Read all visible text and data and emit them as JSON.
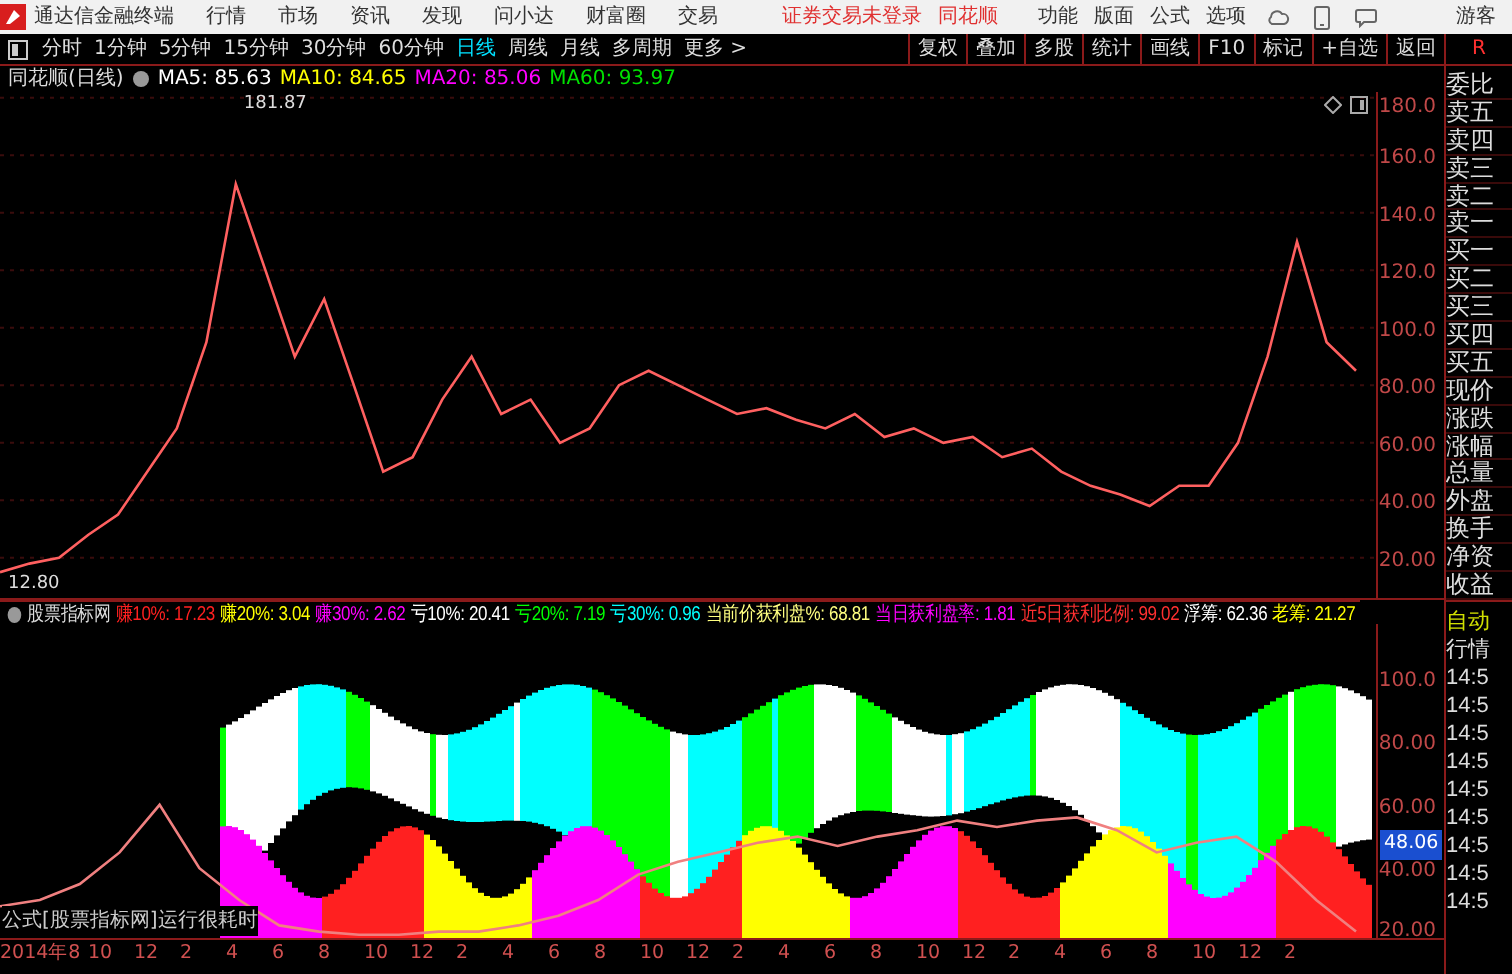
{
  "app": {
    "title": "通达信金融终端",
    "menu": [
      "行情",
      "市场",
      "资讯",
      "发现",
      "问小达",
      "财富圈",
      "交易"
    ],
    "notice": "证券交易未登录",
    "notice_link": "同花顺",
    "tools": [
      "功能",
      "版面",
      "公式",
      "选项"
    ],
    "user": "游客"
  },
  "periods": [
    {
      "label": "分时",
      "selected": false
    },
    {
      "label": "1分钟",
      "selected": false
    },
    {
      "label": "5分钟",
      "selected": false
    },
    {
      "label": "15分钟",
      "selected": false
    },
    {
      "label": "30分钟",
      "selected": false
    },
    {
      "label": "60分钟",
      "selected": false
    },
    {
      "label": "日线",
      "selected": true
    },
    {
      "label": "周线",
      "selected": false
    },
    {
      "label": "月线",
      "selected": false
    },
    {
      "label": "多周期",
      "selected": false
    },
    {
      "label": "更多 >",
      "selected": false
    }
  ],
  "toolbar": [
    "复权",
    "叠加",
    "多股",
    "统计",
    "画线",
    "F10",
    "标记",
    "+自选",
    "返回"
  ],
  "toolbar_badge": "R",
  "price_chart": {
    "title": "同花顺(日线)",
    "ma": [
      {
        "label": "MA5: 85.63",
        "color": "#ffffff"
      },
      {
        "label": "MA10: 84.65",
        "color": "#ffff00"
      },
      {
        "label": "MA20: 85.06",
        "color": "#ff00ff"
      },
      {
        "label": "MA60: 93.97",
        "color": "#00e000"
      }
    ],
    "high_label": "181.87",
    "low_label": "12.80",
    "chart_data": {
      "type": "line",
      "grid": true,
      "ylim": [
        6,
        182
      ],
      "yticks": [
        {
          "value": 180,
          "label": "180.0"
        },
        {
          "value": 160,
          "label": "160.0"
        },
        {
          "value": 140,
          "label": "140.0"
        },
        {
          "value": 120,
          "label": "120.0"
        },
        {
          "value": 100,
          "label": "100.0"
        },
        {
          "value": 80,
          "label": "80.00"
        },
        {
          "value": 60,
          "label": "60.00"
        },
        {
          "value": 40,
          "label": "40.00"
        },
        {
          "value": 20,
          "label": "20.00"
        }
      ],
      "series": [
        {
          "color": "#ff6060",
          "values": [
            15,
            18,
            20,
            28,
            35,
            50,
            65,
            95,
            150,
            120,
            90,
            110,
            80,
            50,
            55,
            75,
            90,
            70,
            75,
            60,
            65,
            80,
            85,
            80,
            75,
            70,
            72,
            68,
            65,
            70,
            62,
            65,
            60,
            62,
            55,
            58,
            50,
            45,
            42,
            38,
            45,
            45,
            60,
            90,
            130,
            95,
            85
          ]
        }
      ]
    }
  },
  "indicator": {
    "title": "股票指标网",
    "items": [
      {
        "label": "赚10%: 17.23",
        "color": "#ff2020"
      },
      {
        "label": "赚20%: 3.04",
        "color": "#ffff00"
      },
      {
        "label": "赚30%: 2.62",
        "color": "#ff00ff"
      },
      {
        "label": "亏10%: 20.41",
        "color": "#ffffff"
      },
      {
        "label": "亏20%: 7.19",
        "color": "#00ff00"
      },
      {
        "label": "亏30%: 0.96",
        "color": "#00ffff"
      },
      {
        "label": "当前价获利盘%: 68.81",
        "color": "#ffff80"
      },
      {
        "label": "当日获利盘率: 1.81",
        "color": "#ff00ff"
      },
      {
        "label": "近5日获利比例: 99.02",
        "color": "#ff3030"
      },
      {
        "label": "浮筹: 62.36",
        "color": "#ffffff"
      },
      {
        "label": "老筹: 21.27",
        "color": "#ffff00"
      }
    ],
    "chart_data": {
      "type": "line",
      "ylim": [
        18,
        117
      ],
      "yticks": [
        {
          "value": 100,
          "label": "100.0"
        },
        {
          "value": 80,
          "label": "80.00"
        },
        {
          "value": 60,
          "label": "60.00"
        },
        {
          "value": 40,
          "label": "40.00"
        },
        {
          "value": 20,
          "label": "20.00"
        }
      ],
      "series": [
        {
          "color": "#f08080",
          "values": [
            28,
            30,
            35,
            45,
            60,
            40,
            30,
            22,
            20,
            19,
            19,
            20,
            20,
            22,
            25,
            30,
            38,
            42,
            45,
            48,
            50,
            47,
            50,
            52,
            55,
            53,
            55,
            56,
            52,
            45,
            48,
            50,
            42,
            30,
            20
          ]
        }
      ]
    },
    "current_value": "48.06",
    "note": "公式[股票指标网]运行很耗时"
  },
  "x_labels": [
    "2014年8",
    "10",
    "12",
    "2",
    "4",
    "6",
    "8",
    "10",
    "12",
    "2",
    "4",
    "6",
    "8",
    "10",
    "12",
    "2",
    "4",
    "6",
    "8",
    "10",
    "12",
    "2",
    "4",
    "6",
    "8",
    "10",
    "12",
    "2"
  ],
  "quote_panel": [
    "委比",
    "卖五",
    "卖四",
    "卖三",
    "卖二",
    "卖一",
    "买一",
    "买二",
    "买三",
    "买四",
    "买五",
    "现价",
    "涨跌",
    "涨幅",
    "总量",
    "外盘",
    "换手",
    "净资",
    "收益"
  ],
  "lower_panel": {
    "mode": "自动",
    "title": "行情",
    "times": [
      "14:5",
      "14:5",
      "14:5",
      "14:5",
      "14:5",
      "14:5",
      "14:5",
      "14:5",
      "14:5"
    ]
  }
}
